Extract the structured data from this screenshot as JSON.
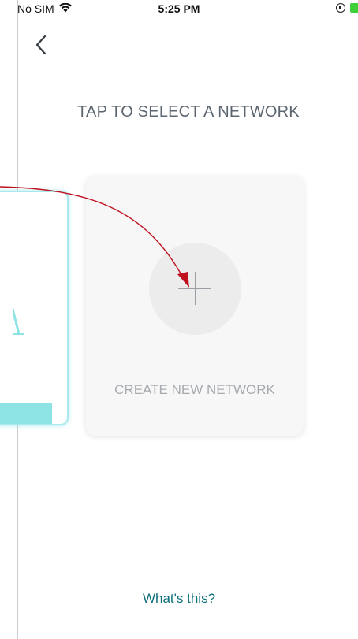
{
  "status_bar": {
    "carrier": "No SIM",
    "time": "5:25 PM",
    "icons": [
      "wifi-icon",
      "orientation-lock-icon",
      "battery-icon"
    ]
  },
  "nav": {
    "back_icon": "chevron-left-icon"
  },
  "page": {
    "title": "TAP TO SELECT A NETWORK"
  },
  "create_card": {
    "icon": "plus-icon",
    "label": "CREATE NEW NETWORK"
  },
  "footer": {
    "link": "What's this?"
  },
  "colors": {
    "title": "#5c6670",
    "card_label": "#a7abb0",
    "link": "#0d6f7a",
    "side_card_accent": "#8ee3e5",
    "annotation_arrow": "#c0111f",
    "battery": "#3fcf3a"
  }
}
